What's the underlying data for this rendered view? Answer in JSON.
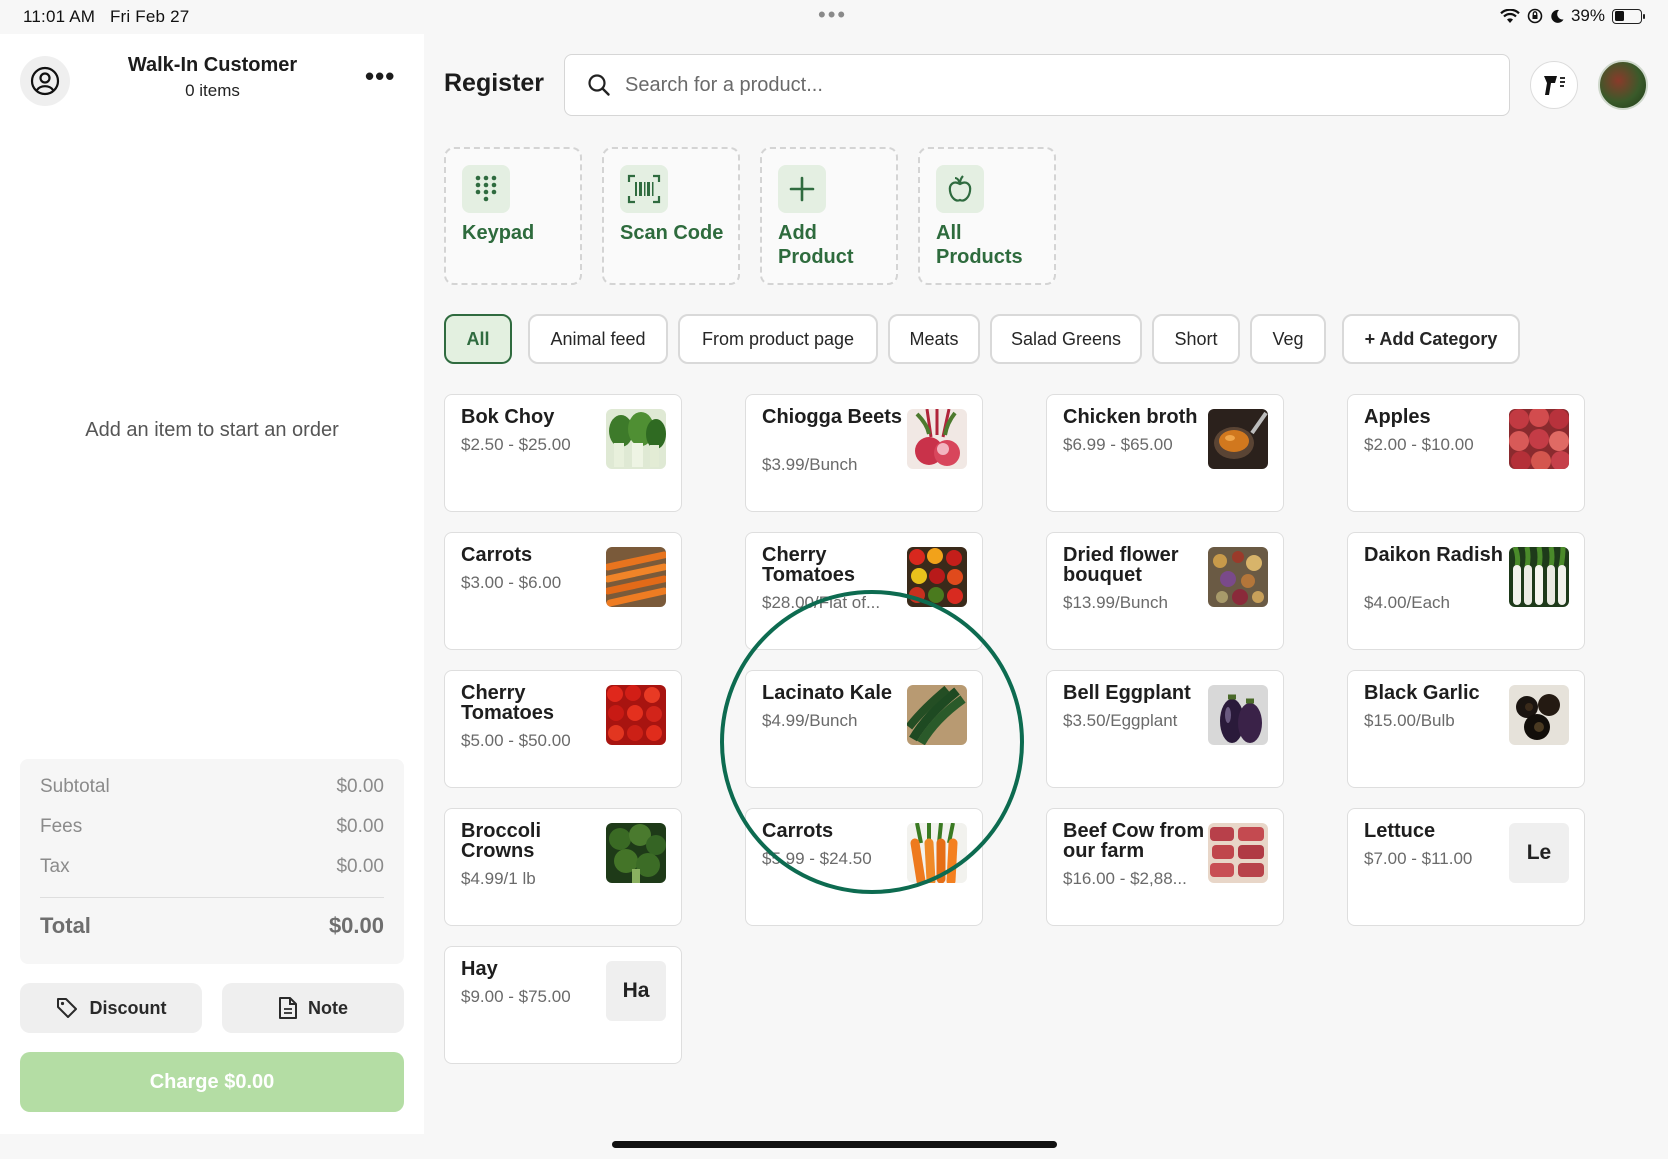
{
  "status_bar": {
    "time": "11:01 AM",
    "date": "Fri Feb 27",
    "battery": "39%",
    "battery_level": 0.39
  },
  "cart": {
    "customer_name": "Walk-In Customer",
    "item_count": "0 items",
    "empty_message": "Add an item to start an order",
    "subtotal_label": "Subtotal",
    "subtotal_value": "$0.00",
    "fees_label": "Fees",
    "fees_value": "$0.00",
    "tax_label": "Tax",
    "tax_value": "$0.00",
    "total_label": "Total",
    "total_value": "$0.00",
    "discount_label": "Discount",
    "note_label": "Note",
    "charge_label": "Charge $0.00"
  },
  "header": {
    "title": "Register",
    "search_placeholder": "Search for a product..."
  },
  "quick_actions": [
    {
      "label": "Keypad",
      "icon": "keypad-icon"
    },
    {
      "label": "Scan Code",
      "icon": "barcode-icon"
    },
    {
      "label": "Add Product",
      "icon": "plus-icon"
    },
    {
      "label": "All Products",
      "icon": "apple-icon"
    }
  ],
  "categories": [
    "All",
    "Animal feed",
    "From product page",
    "Meats",
    "Salad Greens",
    "Short",
    "Veg",
    "+ Add Category"
  ],
  "products": [
    {
      "name": "Bok Choy",
      "price": "$2.50 - $25.00"
    },
    {
      "name": "Chiogga Beets",
      "price": "$3.99/Bunch"
    },
    {
      "name": "Chicken broth",
      "price": "$6.99 - $65.00"
    },
    {
      "name": "Apples",
      "price": "$2.00 - $10.00"
    },
    {
      "name": "Carrots",
      "price": "$3.00 - $6.00"
    },
    {
      "name": "Cherry Tomatoes",
      "price": "$28.00/Flat of..."
    },
    {
      "name": "Dried flower bouquet",
      "price": "$13.99/Bunch"
    },
    {
      "name": "Daikon Radish",
      "price": "$4.00/Each"
    },
    {
      "name": "Cherry Tomatoes",
      "price": "$5.00 - $50.00"
    },
    {
      "name": "Lacinato Kale",
      "price": "$4.99/Bunch"
    },
    {
      "name": "Bell Eggplant",
      "price": "$3.50/Eggplant"
    },
    {
      "name": "Black Garlic",
      "price": "$15.00/Bulb"
    },
    {
      "name": "Broccoli Crowns",
      "price": "$4.99/1 lb"
    },
    {
      "name": "Carrots",
      "price": "$5.99 - $24.50"
    },
    {
      "name": "Beef Cow from our farm",
      "price": "$16.00 - $2,88..."
    },
    {
      "name": "Lettuce",
      "price": "$7.00 - $11.00",
      "abbr": "Le"
    },
    {
      "name": "Hay",
      "price": "$9.00 - $75.00",
      "abbr": "Ha"
    }
  ],
  "colors": {
    "accent": "#2f6b3f",
    "charge_button": "#b4dda4",
    "annotation": "#0d6b50"
  }
}
